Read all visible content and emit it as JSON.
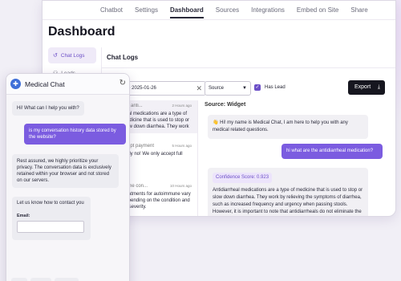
{
  "topnav": {
    "tabs": [
      {
        "label": "Chatbot",
        "active": false
      },
      {
        "label": "Settings",
        "active": false
      },
      {
        "label": "Dashboard",
        "active": true
      },
      {
        "label": "Sources",
        "active": false
      },
      {
        "label": "Integrations",
        "active": false
      },
      {
        "label": "Embed on Site",
        "active": false
      },
      {
        "label": "Share",
        "active": false
      }
    ]
  },
  "dashboard": {
    "title": "Dashboard",
    "sidebar": {
      "items": [
        {
          "label": "Chat Logs",
          "icon": "refresh-icon",
          "active": true
        },
        {
          "label": "Leads",
          "icon": "users-icon",
          "active": false
        }
      ]
    },
    "chat_logs": {
      "title": "Chat Logs",
      "date_range": "9 ~ 2025-01-26",
      "source_select": "Source",
      "has_lead_label": "Has Lead",
      "has_lead_checked": true,
      "export_label": "Export",
      "list": [
        {
          "title": "the anti...",
          "time": "2 Hours ago",
          "preview": "heal medications are a type of medicine that is used to stop or slow down diarrhea. They work by..."
        },
        {
          "title": "ccept payment",
          "time": "5 Hours ago",
          "preview": "ately no! We only accept full"
        },
        {
          "title": "same con...",
          "time": "10 Hours ago",
          "preview": "treatments for autoimmune vary depending on the condition and its severity."
        }
      ],
      "detail": {
        "source_label": "Source: Widget",
        "greeting": "👋 Hi! my name is Medical Chat, I am here to help you with any medical related questions.",
        "user_question": "hi what are the antidiarrheal medication?",
        "confidence": "Confidence Score: 0.923",
        "answer": "Antidiarrheal medications are a type of medicine that is used to stop or slow down diarrhea. They work by relieving the symptoms of diarrhea, such as increased frequency and urgency when passing stools. However, it is important to note that antidiarrheals do not eliminate the underlying cause of diarrhea. Once you stop taking an"
      }
    }
  },
  "widget": {
    "title": "Medical Chat",
    "messages": {
      "greeting": "Hi! What can I help you with?",
      "user": "is my conversation history data stored by the website?",
      "reply": "Rest assured, we highly prioritize your privacy. The conversation data is exclusively retained within your browser and not stored on our servers.",
      "contact_prompt": "Let us know how to contact you",
      "email_label": "Email:"
    }
  },
  "colors": {
    "accent": "#7b5ce0",
    "export_bg": "#16161f",
    "widget_logo": "#3f6fd8"
  }
}
